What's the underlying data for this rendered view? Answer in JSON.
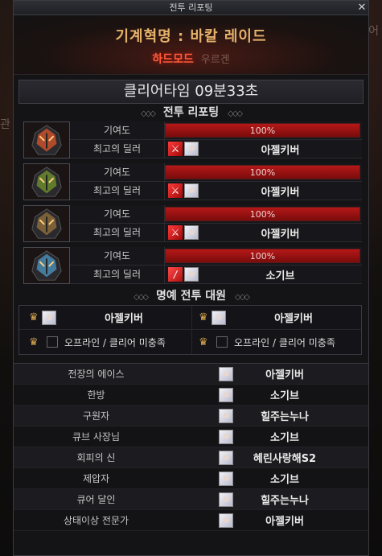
{
  "window": {
    "title": "전투 리포팅",
    "close_glyph": "✕"
  },
  "background": {
    "text_right": "스핏파이어",
    "text_left": "관"
  },
  "raid": {
    "name": "기계혁명 : 바칼 레이드",
    "mode": "하드모드",
    "mode_extra": "우르겐"
  },
  "clear_time": "클리어타임   09분33초",
  "report": {
    "title": "전투 리포팅",
    "contribution_label": "기여도",
    "best_dealer_label": "최고의 딜러",
    "bosses": [
      {
        "portrait": "fire-dragon-icon",
        "accent": "#c7502a",
        "contribution": "100%",
        "contribution_value": 100,
        "class_icon": "sword-class-icon",
        "dealer": "아젤키버"
      },
      {
        "portrait": "poison-dragon-icon",
        "accent": "#6a8a2a",
        "contribution": "100%",
        "contribution_value": 100,
        "class_icon": "sword-class-icon",
        "dealer": "아젤키버"
      },
      {
        "portrait": "metal-dragon-icon",
        "accent": "#8a6a3a",
        "contribution": "100%",
        "contribution_value": 100,
        "class_icon": "sword-class-icon",
        "dealer": "아젤키버"
      },
      {
        "portrait": "ice-dragon-icon",
        "accent": "#4a8ab0",
        "contribution": "100%",
        "contribution_value": 100,
        "class_icon": "blade-class-icon",
        "dealer": "소기브"
      }
    ]
  },
  "honor": {
    "title": "명예 전투 대원",
    "rows": [
      [
        {
          "name": "아젤키버"
        },
        {
          "name": "아젤키버"
        }
      ],
      [
        {
          "status": "오프라인 / 클리어 미충족"
        },
        {
          "status": "오프라인 / 클리어 미충족"
        }
      ]
    ]
  },
  "awards": [
    {
      "title": "전장의 에이스",
      "player": "아젤키버"
    },
    {
      "title": "한방",
      "player": "소기브"
    },
    {
      "title": "구원자",
      "player": "힐주는누나"
    },
    {
      "title": "큐브 사장님",
      "player": "소기브"
    },
    {
      "title": "회피의 신",
      "player": "혜린사랑해S2"
    },
    {
      "title": "제압자",
      "player": "소기브"
    },
    {
      "title": "큐어 달인",
      "player": "힐주는누나"
    },
    {
      "title": "상태이상 전문가",
      "player": "아젤키버"
    }
  ]
}
